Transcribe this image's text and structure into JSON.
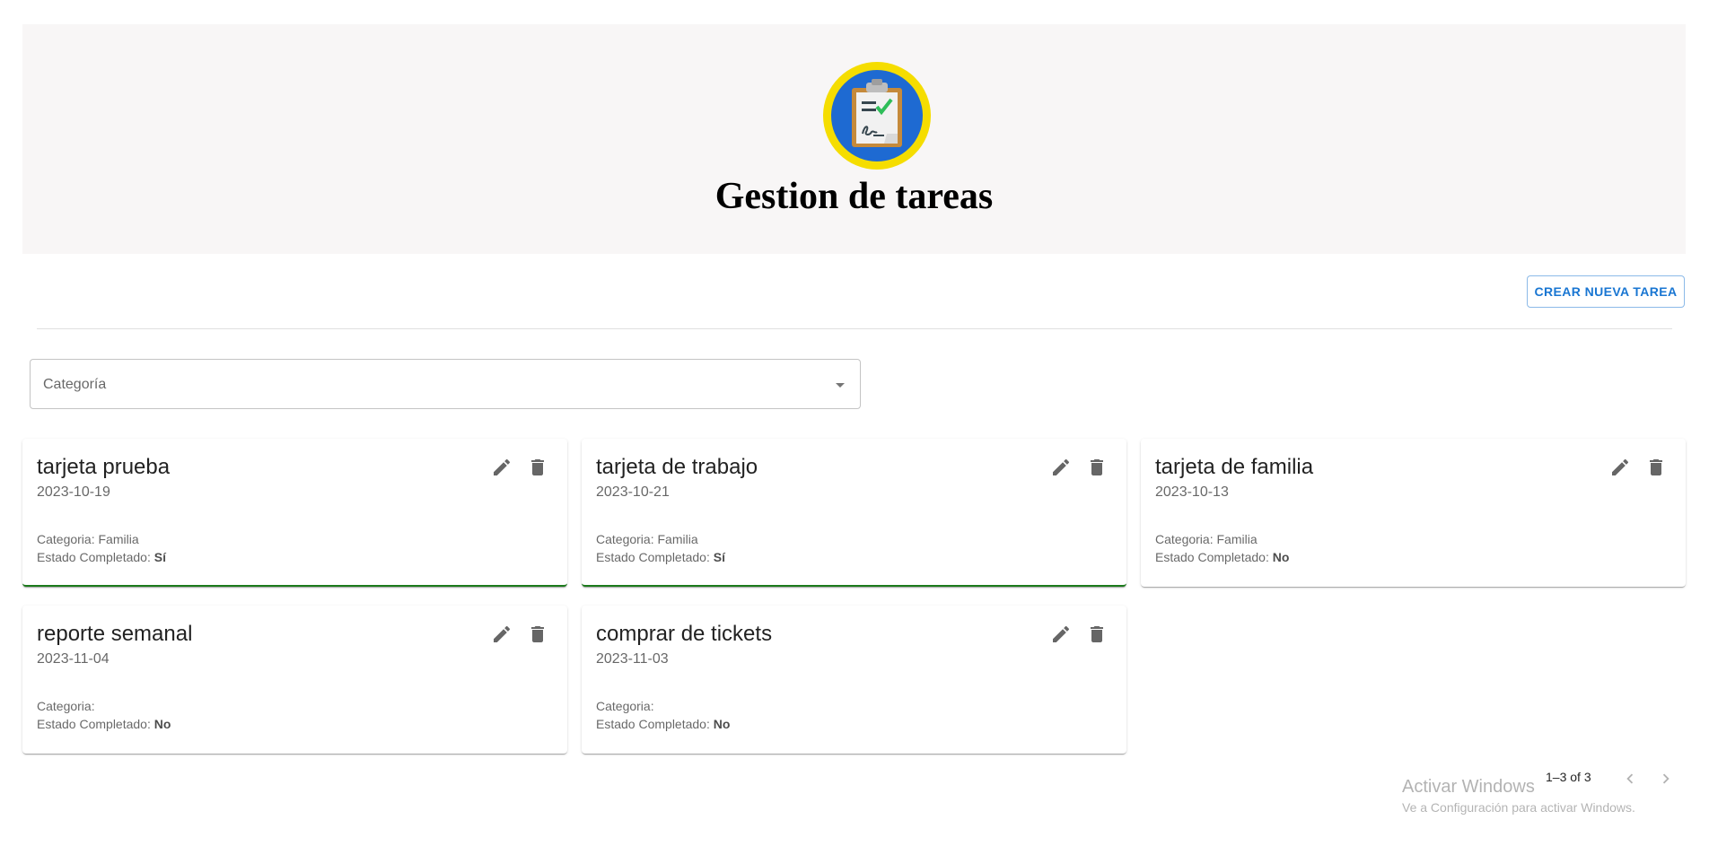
{
  "header": {
    "title": "Gestion de tareas",
    "logo_icon": "clipboard-checklist-icon",
    "logo_colors": {
      "ring": "#f5dd00",
      "circle": "#1e6ad2"
    }
  },
  "toolbar": {
    "create_label": "Crear nueva tarea"
  },
  "filter": {
    "category_label": "Categoría"
  },
  "colors": {
    "accent": "#1976d2",
    "completed_border": "#1b7a1b"
  },
  "tasks": [
    {
      "title": "tarjeta prueba",
      "date": "2023-10-19",
      "category_label": "Categoria:",
      "category": "Familia",
      "state_label": "Estado Completado:",
      "state": "Sí",
      "completed": true
    },
    {
      "title": "tarjeta de trabajo",
      "date": "2023-10-21",
      "category_label": "Categoria:",
      "category": "Familia",
      "state_label": "Estado Completado:",
      "state": "Sí",
      "completed": true
    },
    {
      "title": "tarjeta de familia",
      "date": "2023-10-13",
      "category_label": "Categoria:",
      "category": "Familia",
      "state_label": "Estado Completado:",
      "state": "No",
      "completed": false
    },
    {
      "title": "reporte semanal",
      "date": "2023-11-04",
      "category_label": "Categoria:",
      "category": "",
      "state_label": "Estado Completado:",
      "state": "No",
      "completed": false
    },
    {
      "title": "comprar de tickets",
      "date": "2023-11-03",
      "category_label": "Categoria:",
      "category": "",
      "state_label": "Estado Completado:",
      "state": "No",
      "completed": false
    }
  ],
  "pagination": {
    "range_text": "1–3 of 3"
  },
  "watermark": {
    "title": "Activar Windows",
    "subtitle": "Ve a Configuración para activar Windows."
  }
}
